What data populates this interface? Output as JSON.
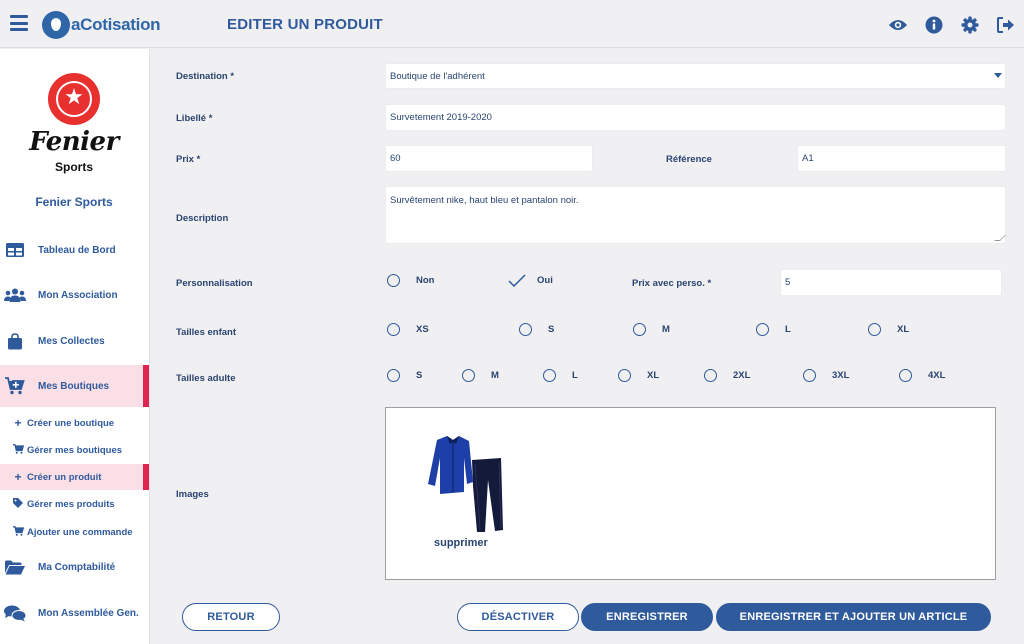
{
  "header": {
    "logo_text": "aCotisation",
    "page_title": "EDITER UN PRODUIT"
  },
  "sidebar": {
    "club_logo_line1": "Fenier",
    "club_logo_line2": "Sports",
    "club_name": "Fenier Sports",
    "items": [
      {
        "label": "Tableau de Bord",
        "icon": "dashboard-icon"
      },
      {
        "label": "Mon Association",
        "icon": "users-icon"
      },
      {
        "label": "Mes Collectes",
        "icon": "bag-icon"
      },
      {
        "label": "Mes Boutiques",
        "icon": "cart-plus-icon"
      },
      {
        "label": "Ma Comptabilité",
        "icon": "folder-open-icon"
      },
      {
        "label": "Mon Assemblée Gen.",
        "icon": "comments-icon"
      }
    ],
    "sub_items": [
      {
        "label": "Créer une boutique",
        "icon": "plus-icon"
      },
      {
        "label": "Gérer mes boutiques",
        "icon": "cart-icon"
      },
      {
        "label": "Créer un produit",
        "icon": "plus-icon"
      },
      {
        "label": "Gérer mes produits",
        "icon": "tag-icon"
      },
      {
        "label": "Ajouter une commande",
        "icon": "cart-icon"
      }
    ]
  },
  "form": {
    "destination_label": "Destination *",
    "destination_value": "Boutique de l'adhérent",
    "libelle_label": "Libellé *",
    "libelle_value": "Survetement 2019-2020",
    "prix_label": "Prix *",
    "prix_value": "60",
    "reference_label": "Référence",
    "reference_value": "A1",
    "description_label": "Description",
    "description_value": "Survêtement nike, haut bleu et pantalon noir.",
    "perso_label": "Personnalisation",
    "perso_options": [
      {
        "label": "Non",
        "checked": false
      },
      {
        "label": "Oui",
        "checked": true
      }
    ],
    "prix_perso_label": "Prix avec perso. *",
    "prix_perso_value": "5",
    "tailles_enfant_label": "Tailles enfant",
    "tailles_enfant": [
      "XS",
      "S",
      "M",
      "L",
      "XL"
    ],
    "tailles_adulte_label": "Tailles adulte",
    "tailles_adulte": [
      "S",
      "M",
      "L",
      "XL",
      "2XL",
      "3XL",
      "4XL"
    ],
    "images_label": "Images",
    "delete_image": "supprimer"
  },
  "buttons": {
    "retour": "RETOUR",
    "desactiver": "DÉSACTIVER",
    "enregistrer": "ENREGISTRER",
    "enregistrer_ajouter": "ENREGISTRER ET AJOUTER UN ARTICLE"
  },
  "colors": {
    "primary": "#2f5a9c",
    "active_bg": "#fbdfe6",
    "active_bar": "#e0244f",
    "background": "#f0eff2"
  }
}
